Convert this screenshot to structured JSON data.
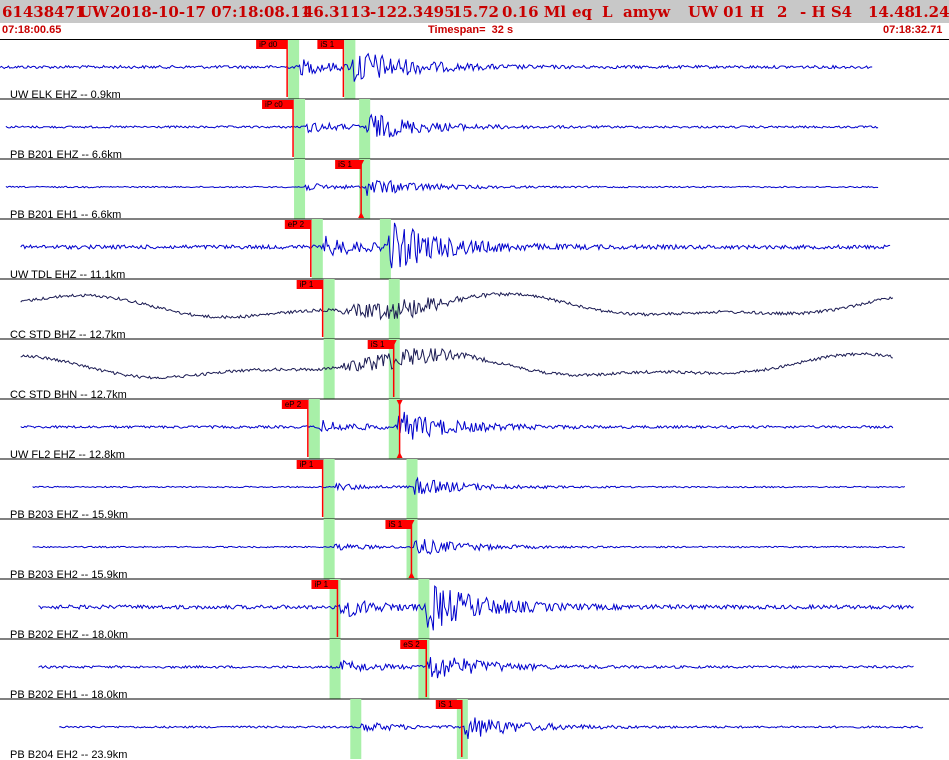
{
  "header": {
    "event_id": "61438471",
    "network": "UW",
    "origin_datetime": "2018-10-17 07:18:08.11",
    "latitude": "46.3113",
    "longitude": "-122.3495",
    "depth": "15.72",
    "magnitude": "0.16 Ml",
    "event_type": "eq",
    "flag": "L",
    "analyst": "amyw",
    "net_code": "UW 01",
    "quality": "H",
    "count": "2",
    "extra": "- H S4",
    "value1": "14.48",
    "value2": "1.24"
  },
  "subheader": {
    "start_time": "07:18:00.65",
    "timespan": "Timespan=  32 s",
    "end_time": "07:18:32.71"
  },
  "colors": {
    "header_bg": "#c8c8c8",
    "header_text": "#c80000",
    "trace_short_period": "#0000cc",
    "trace_broadband": "#1c1c54",
    "pick_flag": "#ff0000",
    "pick_window": "#a8f0a8"
  },
  "traces": [
    {
      "label": "UW ELK EHZ -- 0.9km",
      "color": "blue",
      "start": 0.001,
      "end": 29.5,
      "amp": 0.75,
      "kind": "sp",
      "picks": [
        {
          "label": "iP d0",
          "time": 9.7,
          "marker": "none"
        },
        {
          "label": "iS 1",
          "time": 11.6,
          "marker": "none"
        }
      ],
      "windows": [
        {
          "time": 9.7
        },
        {
          "time": 11.6
        }
      ]
    },
    {
      "label": "PB B201 EHZ -- 6.6km",
      "color": "blue",
      "start": 0.2,
      "end": 29.7,
      "amp": 0.55,
      "kind": "sp",
      "picks": [
        {
          "label": "iP c0",
          "time": 9.9,
          "marker": "none"
        }
      ],
      "windows": [
        {
          "time": 9.9
        },
        {
          "time": 12.1
        }
      ]
    },
    {
      "label": "PB B201 EH1 -- 6.6km",
      "color": "blue",
      "start": 0.2,
      "end": 29.7,
      "amp": 0.35,
      "kind": "sp",
      "picks": [
        {
          "label": "iS 1",
          "time": 12.2,
          "marker": "both"
        }
      ],
      "windows": [
        {
          "time": 9.9
        },
        {
          "time": 12.1
        }
      ]
    },
    {
      "label": "UW TDL EHZ -- 11.1km",
      "color": "blue",
      "start": 0.7,
      "end": 30.1,
      "amp": 1.0,
      "kind": "sp",
      "picks": [
        {
          "label": "eP 2",
          "time": 10.5,
          "marker": "none"
        }
      ],
      "windows": [
        {
          "time": 10.5
        },
        {
          "time": 12.8
        }
      ]
    },
    {
      "label": "CC STD BHZ -- 12.7km",
      "color": "dark",
      "start": 0.7,
      "end": 30.2,
      "amp": 1.0,
      "kind": "bb",
      "picks": [
        {
          "label": "iP 1",
          "time": 10.9,
          "marker": "none"
        }
      ],
      "windows": [
        {
          "time": 10.9
        },
        {
          "time": 13.1
        }
      ]
    },
    {
      "label": "CC STD BHN -- 12.7km",
      "color": "dark",
      "start": 0.7,
      "end": 30.2,
      "amp": 1.0,
      "kind": "bb",
      "picks": [
        {
          "label": "iS 1",
          "time": 13.3,
          "marker": "down"
        }
      ],
      "windows": [
        {
          "time": 10.9
        },
        {
          "time": 13.1
        }
      ]
    },
    {
      "label": "UW FL2 EHZ -- 12.8km",
      "color": "blue",
      "start": 0.7,
      "end": 30.2,
      "amp": 0.65,
      "kind": "sp",
      "picks": [
        {
          "label": "eP 2",
          "time": 10.4,
          "marker": "none"
        },
        {
          "label": "",
          "time": 13.5,
          "marker": "both"
        }
      ],
      "windows": [
        {
          "time": 10.4
        },
        {
          "time": 13.1
        }
      ]
    },
    {
      "label": "PB B203 EHZ -- 15.9km",
      "color": "blue",
      "start": 1.1,
      "end": 30.6,
      "amp": 0.35,
      "kind": "sp",
      "picks": [
        {
          "label": "iP 1",
          "time": 10.9,
          "marker": "none"
        }
      ],
      "windows": [
        {
          "time": 10.9
        },
        {
          "time": 13.7
        }
      ]
    },
    {
      "label": "PB B203 EH2 -- 15.9km",
      "color": "blue",
      "start": 1.1,
      "end": 30.6,
      "amp": 0.35,
      "kind": "sp",
      "picks": [
        {
          "label": "iS 1",
          "time": 13.9,
          "marker": "both"
        }
      ],
      "windows": [
        {
          "time": 10.9
        },
        {
          "time": 13.7
        }
      ]
    },
    {
      "label": "PB B202 EHZ -- 18.0km",
      "color": "blue",
      "start": 1.3,
      "end": 30.9,
      "amp": 1.0,
      "kind": "sp",
      "picks": [
        {
          "label": "iP 1",
          "time": 11.4,
          "marker": "none"
        }
      ],
      "windows": [
        {
          "time": 11.1
        },
        {
          "time": 14.1
        }
      ]
    },
    {
      "label": "PB B202 EH1 -- 18.0km",
      "color": "blue",
      "start": 1.3,
      "end": 30.9,
      "amp": 0.6,
      "kind": "sp",
      "picks": [
        {
          "label": "eS 2",
          "time": 14.4,
          "marker": "none"
        }
      ],
      "windows": [
        {
          "time": 11.1
        },
        {
          "time": 14.1
        }
      ]
    },
    {
      "label": "PB B204 EH2 -- 23.9km",
      "color": "blue",
      "start": 2.0,
      "end": 31.2,
      "amp": 0.5,
      "kind": "sp",
      "picks": [
        {
          "label": "iS 1",
          "time": 15.6,
          "marker": "none"
        }
      ],
      "windows": [
        {
          "time": 11.8
        },
        {
          "time": 15.4
        }
      ]
    }
  ]
}
